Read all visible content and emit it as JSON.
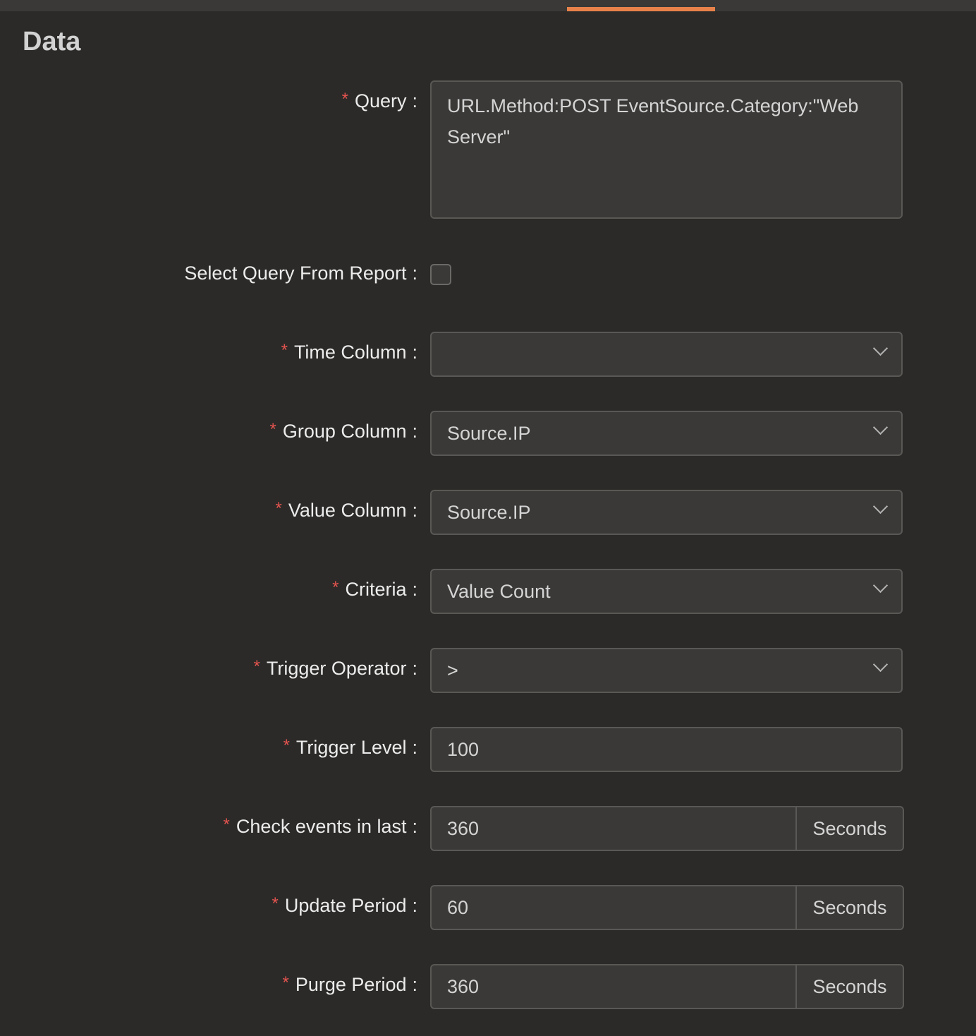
{
  "section": {
    "title": "Data"
  },
  "fields": {
    "query": {
      "label": "Query",
      "value": "URL.Method:POST EventSource.Category:\"Web Server\""
    },
    "select_query_from_report": {
      "label": "Select Query From Report"
    },
    "time_column": {
      "label": "Time Column",
      "value": ""
    },
    "group_column": {
      "label": "Group Column",
      "value": "Source.IP"
    },
    "value_column": {
      "label": "Value Column",
      "value": "Source.IP"
    },
    "criteria": {
      "label": "Criteria",
      "value": "Value Count"
    },
    "trigger_operator": {
      "label": "Trigger Operator",
      "value": ">"
    },
    "trigger_level": {
      "label": "Trigger Level",
      "value": "100"
    },
    "check_events_in_last": {
      "label": "Check events in last",
      "value": "360",
      "unit": "Seconds"
    },
    "update_period": {
      "label": "Update Period",
      "value": "60",
      "unit": "Seconds"
    },
    "purge_period": {
      "label": "Purge Period",
      "value": "360",
      "unit": "Seconds"
    }
  },
  "ui": {
    "required_marker": "*",
    "colon": ":"
  },
  "colors": {
    "background": "#2b2a28",
    "field_background": "#3a3937",
    "accent": "#e8824a",
    "required": "#e5544f"
  }
}
